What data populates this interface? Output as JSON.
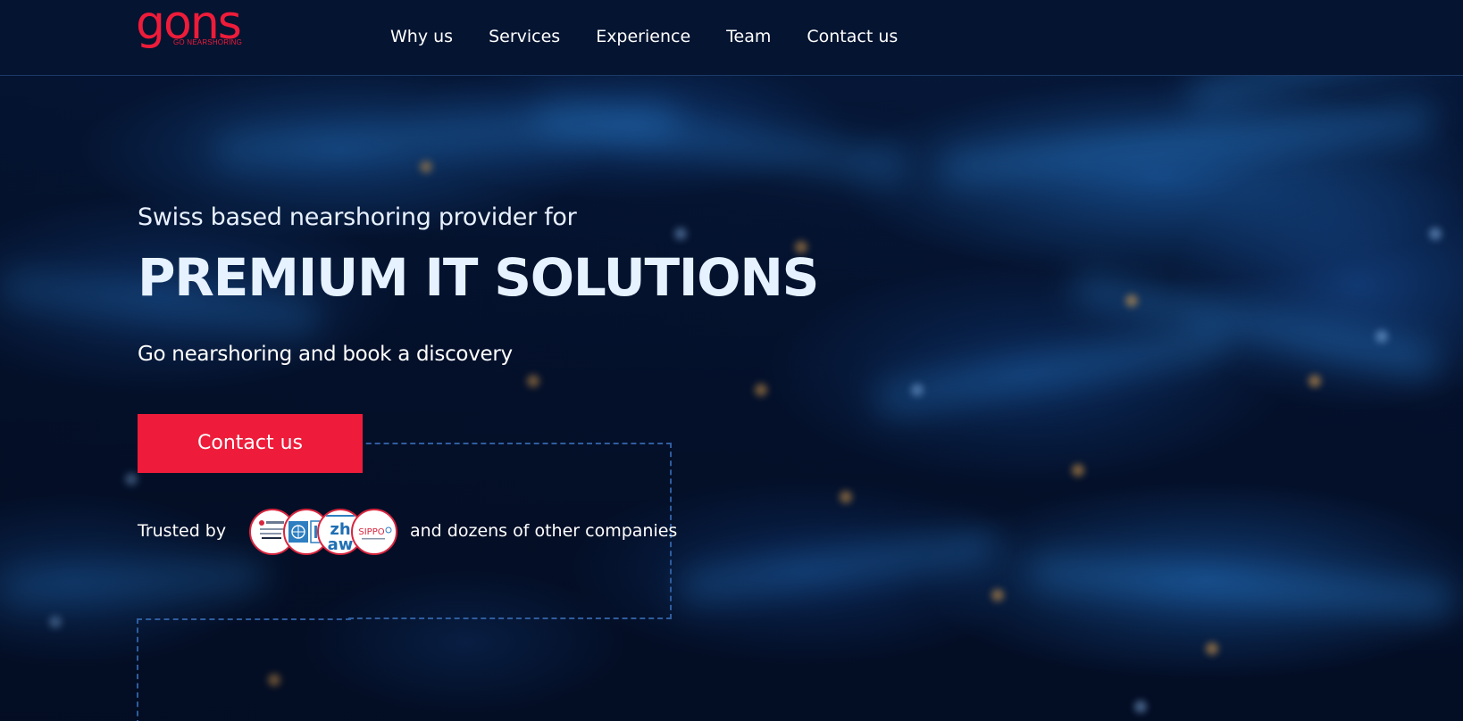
{
  "brand": {
    "wordmark": "gons",
    "tagline": "GO NEARSHORING",
    "accent_color": "#ee1c3a"
  },
  "nav": {
    "items": [
      {
        "label": "Why us"
      },
      {
        "label": "Services"
      },
      {
        "label": "Experience"
      },
      {
        "label": "Team"
      },
      {
        "label": "Contact us"
      }
    ]
  },
  "hero": {
    "tagline": "Swiss based nearshoring provider for",
    "headline": "PREMIUM IT SOLUTIONS",
    "subline": "Go nearshoring and book a discovery",
    "cta_label": "Contact us",
    "trusted_label": "Trusted by",
    "trusted_tail": "and dozens of other companies",
    "partner_logos": [
      {
        "icon": "partner-logo-1"
      },
      {
        "icon": "un-emblem-logo"
      },
      {
        "icon": "zhaw-logo",
        "text_top": "zh",
        "text_bottom": "aw"
      },
      {
        "icon": "sippo-logo",
        "text": "SIPPO"
      }
    ]
  }
}
